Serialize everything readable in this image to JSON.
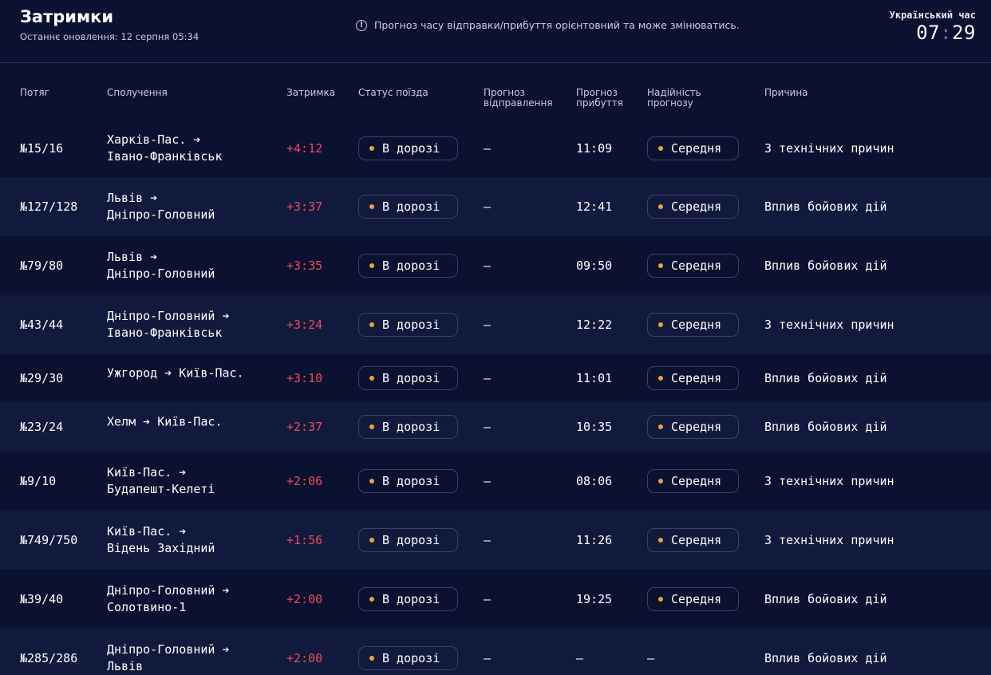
{
  "header": {
    "title": "Затримки",
    "updated": "Останнє оновлення: 12 серпня 05:34",
    "notice": "Прогноз часу відправки/прибуття орієнтовний та може змінюватись.",
    "clock_label": "Український час",
    "clock_hours": "07",
    "clock_sep": ":",
    "clock_minutes": "29"
  },
  "columns": {
    "train": "Потяг",
    "route": "Сполучення",
    "delay": "Затримка",
    "status": "Статус поїзда",
    "dep_1": "Прогноз",
    "dep_2": "відправлення",
    "arr_1": "Прогноз",
    "arr_2": "прибуття",
    "rel_1": "Надійність",
    "rel_2": "прогнозу",
    "reason": "Причина"
  },
  "colors": {
    "background": "#0b1130",
    "row_alt": "#111a3d",
    "delay": "#f04a56",
    "dot": "#f0a040"
  },
  "rows": [
    {
      "train": "№15/16",
      "route_1": "Харків-Пас. ➔",
      "route_2": "Івано-Франківськ",
      "delay": "+4:12",
      "status": "В дорозі",
      "dep": "—",
      "arr": "11:09",
      "rel": "Середня",
      "reason": "З технічних причин"
    },
    {
      "train": "№127/128",
      "route_1": "Львів ➔",
      "route_2": "Дніпро-Головний",
      "delay": "+3:37",
      "status": "В дорозі",
      "dep": "—",
      "arr": "12:41",
      "rel": "Середня",
      "reason": "Вплив бойових дій"
    },
    {
      "train": "№79/80",
      "route_1": "Львів ➔",
      "route_2": "Дніпро-Головний",
      "delay": "+3:35",
      "status": "В дорозі",
      "dep": "—",
      "arr": "09:50",
      "rel": "Середня",
      "reason": "Вплив бойових дій"
    },
    {
      "train": "№43/44",
      "route_1": "Дніпро-Головний ➔",
      "route_2": "Івано-Франківськ",
      "delay": "+3:24",
      "status": "В дорозі",
      "dep": "—",
      "arr": "12:22",
      "rel": "Середня",
      "reason": "З технічних причин"
    },
    {
      "train": "№29/30",
      "route_1": "Ужгород ➔ Київ-Пас.",
      "route_2": "",
      "delay": "+3:10",
      "status": "В дорозі",
      "dep": "—",
      "arr": "11:01",
      "rel": "Середня",
      "reason": "Вплив бойових дій"
    },
    {
      "train": "№23/24",
      "route_1": "Хелм ➔ Київ-Пас.",
      "route_2": "",
      "delay": "+2:37",
      "status": "В дорозі",
      "dep": "—",
      "arr": "10:35",
      "rel": "Середня",
      "reason": "Вплив бойових дій"
    },
    {
      "train": "№9/10",
      "route_1": "Київ-Пас. ➔",
      "route_2": "Будапешт-Келеті",
      "delay": "+2:06",
      "status": "В дорозі",
      "dep": "—",
      "arr": "08:06",
      "rel": "Середня",
      "reason": "З технічних причин"
    },
    {
      "train": "№749/750",
      "route_1": "Київ-Пас. ➔",
      "route_2": "Відень Західний",
      "delay": "+1:56",
      "status": "В дорозі",
      "dep": "—",
      "arr": "11:26",
      "rel": "Середня",
      "reason": "З технічних причин"
    },
    {
      "train": "№39/40",
      "route_1": "Дніпро-Головний ➔",
      "route_2": "Солотвино-1",
      "delay": "+2:00",
      "status": "В дорозі",
      "dep": "—",
      "arr": "19:25",
      "rel": "Середня",
      "reason": "Вплив бойових дій"
    },
    {
      "train": "№285/286",
      "route_1": "Дніпро-Головний ➔",
      "route_2": "Львів",
      "delay": "+2:00",
      "status": "В дорозі",
      "dep": "—",
      "arr": "—",
      "rel": "—",
      "reason": "Вплив бойових дій"
    }
  ]
}
